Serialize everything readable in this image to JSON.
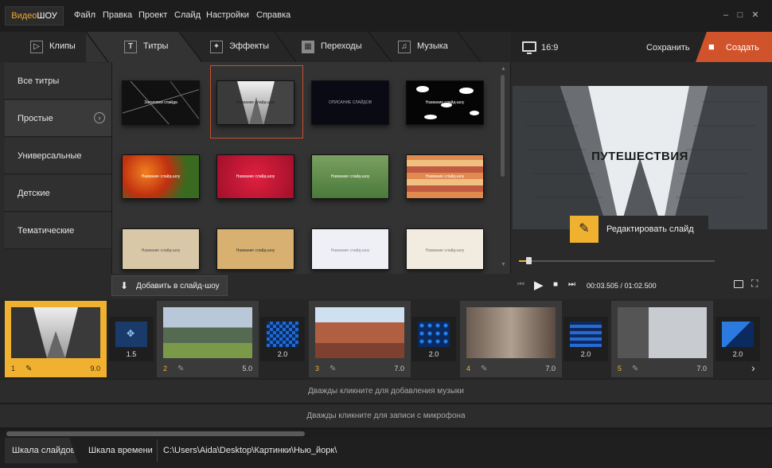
{
  "app": {
    "logo_part1": "Видео",
    "logo_part2": "ШОУ"
  },
  "menu": [
    "Файл",
    "Правка",
    "Проект",
    "Слайд",
    "Настройки",
    "Справка"
  ],
  "window_controls": [
    "minimize-icon",
    "maximize-icon",
    "close-icon"
  ],
  "tabs": [
    {
      "label": "Клипы",
      "icon": "play-icon"
    },
    {
      "label": "Титры",
      "icon": "text-icon"
    },
    {
      "label": "Эффекты",
      "icon": "magic-wand-icon"
    },
    {
      "label": "Переходы",
      "icon": "film-icon"
    },
    {
      "label": "Музыка",
      "icon": "music-icon"
    }
  ],
  "active_tab": "Титры",
  "categories": [
    {
      "label": "Все титры"
    },
    {
      "label": "Простые"
    },
    {
      "label": "Универсальные"
    },
    {
      "label": "Детские"
    },
    {
      "label": "Тематические"
    }
  ],
  "active_category": "Простые",
  "title_thumbs": [
    {
      "caption": "Заголовок слайда"
    },
    {
      "caption": "Название слайд-шоу"
    },
    {
      "caption": "ОПИСАНИЕ СЛАЙДОВ"
    },
    {
      "caption": "Название слайд-шоу"
    },
    {
      "caption": "Название слайд-шоу"
    },
    {
      "caption": "Название слайд-шоу"
    },
    {
      "caption": "Название слайд-шоу"
    },
    {
      "caption": "Название слайд-шоу"
    },
    {
      "caption": "Название слайд-шоу"
    },
    {
      "caption": "Название слайд-шоу"
    },
    {
      "caption": "Название слайд-шоу"
    },
    {
      "caption": "Название слайд-шоу"
    }
  ],
  "preview": {
    "aspect": "16:9",
    "save_label": "Сохранить",
    "create_label": "Создать",
    "title_text": "ПУТЕШЕСТВИЯ",
    "edit_label": "Редактировать слайд",
    "time": "00:03.505 / 01:02.500",
    "seek_progress": 0.05
  },
  "add_button": "Добавить в слайд-шоу",
  "slides": [
    {
      "num": "1",
      "duration": "9.0"
    },
    {
      "num": "2",
      "duration": "5.0"
    },
    {
      "num": "3",
      "duration": "7.0"
    },
    {
      "num": "4",
      "duration": "7.0"
    },
    {
      "num": "5",
      "duration": "7.0"
    }
  ],
  "transitions": [
    {
      "duration": "1.5"
    },
    {
      "duration": "2.0"
    },
    {
      "duration": "2.0"
    },
    {
      "duration": "2.0"
    },
    {
      "duration": "2.0"
    }
  ],
  "tracks": {
    "music": "Дважды кликните для добавления музыки",
    "mic": "Дважды кликните для записи с микрофона"
  },
  "bottom": {
    "tab1": "Шкала слайдов",
    "tab2": "Шкала времени",
    "path": "C:\\Users\\Aida\\Desktop\\Картинки\\Нью_йорк\\"
  },
  "colors": {
    "accent": "#f0b030",
    "create": "#d0532b",
    "selection": "#d05a2a"
  }
}
